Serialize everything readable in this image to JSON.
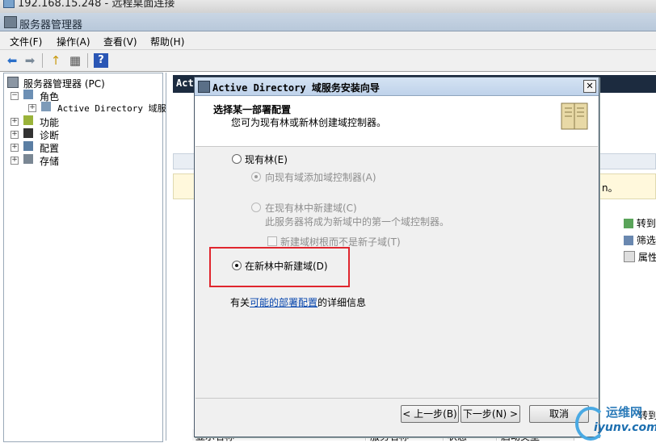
{
  "remote_title": "192.168.15.248 - 远程桌面连接",
  "window_title": "服务器管理器",
  "menu": [
    "文件(F)",
    "操作(A)",
    "查看(V)",
    "帮助(H)"
  ],
  "tree": {
    "root": "服务器管理器 (PC)",
    "roles": "角色",
    "ad": "Active Directory 域服务",
    "features": "功能",
    "diagnostics": "诊断",
    "config": "配置",
    "storage": "存储"
  },
  "right_pane": {
    "header_partial": "Act",
    "info_tail": "n。",
    "actions": [
      "转到",
      "筛选",
      "属性"
    ],
    "columns": [
      "显示名称",
      "服务名称",
      "状态",
      "启动类型"
    ],
    "bottom_action": "转到"
  },
  "dialog": {
    "title": "Active Directory 域服务安装向导",
    "heading": "选择某一部署配置",
    "subheading": "您可为现有林或新林创建域控制器。",
    "opt_existing_forest": "现有林(E)",
    "opt_add_dc": "向现有域添加域控制器(A)",
    "opt_new_domain": "在现有林中新建域(C)",
    "opt_new_domain_desc": "此服务器将成为新域中的第一个域控制器。",
    "chk_tree_root": "新建域树根而不是新子域(T)",
    "opt_new_forest": "在新林中新建域(D)",
    "more_info_prefix": "有关",
    "more_info_link": "可能的部署配置",
    "more_info_suffix": "的详细信息",
    "btn_back": "< 上一步(B)",
    "btn_next": "下一步(N) >",
    "btn_cancel": "取消",
    "selected_option": "在新林中新建域(D)"
  },
  "watermark": {
    "cn": "运维网",
    "url": "iyunv.com"
  },
  "colors": {
    "highlight": "#e0262e",
    "link": "#0645ad",
    "header_bg": "#1c2b3f"
  }
}
